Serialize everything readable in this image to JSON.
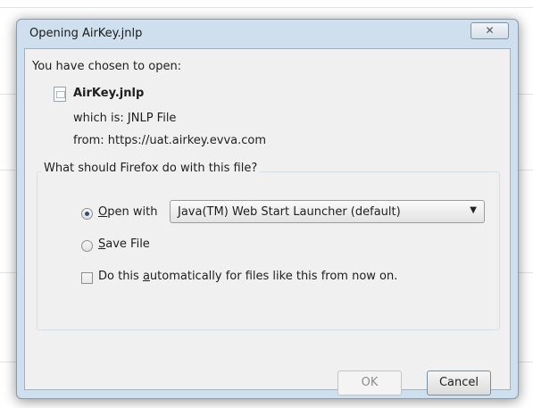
{
  "dialog": {
    "title": "Opening AirKey.jnlp",
    "close_glyph": "✕"
  },
  "content": {
    "chosen_label": "You have chosen to open:",
    "file_name": "AirKey.jnlp",
    "which_is": "which is:  JNLP File",
    "from": "from:  https://uat.airkey.evva.com"
  },
  "options": {
    "group_label": "What should Firefox do with this file?",
    "open_with": {
      "mnemonic": "O",
      "rest": "pen with",
      "selected": true
    },
    "application": "Java(TM) Web Start Launcher (default)",
    "save_file": {
      "mnemonic": "S",
      "rest": "ave File",
      "selected": false
    },
    "auto": {
      "pre": "Do this ",
      "mnemonic": "a",
      "rest": "utomatically for files like this from now on.",
      "checked": false
    }
  },
  "buttons": {
    "ok": "OK",
    "cancel": "Cancel"
  }
}
